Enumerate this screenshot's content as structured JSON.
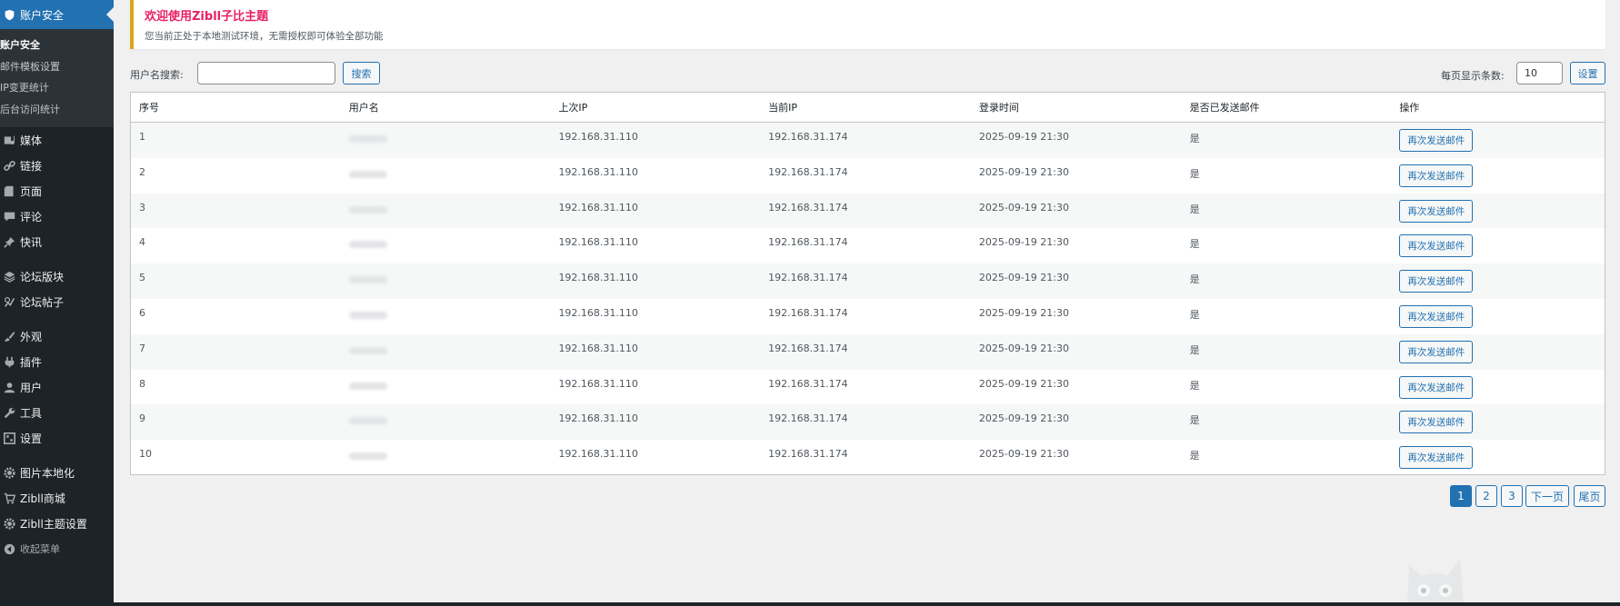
{
  "sidebar": {
    "current": "账户安全",
    "submenu": [
      "账户安全",
      "邮件模板设置",
      "IP变更统计",
      "后台访问统计"
    ],
    "items": [
      {
        "label": "媒体",
        "icon": "media-icon"
      },
      {
        "label": "链接",
        "icon": "link-icon"
      },
      {
        "label": "页面",
        "icon": "page-icon"
      },
      {
        "label": "评论",
        "icon": "comment-icon"
      },
      {
        "label": "快讯",
        "icon": "pin-icon"
      },
      {
        "label": "论坛版块",
        "icon": "forum-icon"
      },
      {
        "label": "论坛帖子",
        "icon": "post-icon"
      },
      {
        "label": "外观",
        "icon": "brush-icon"
      },
      {
        "label": "插件",
        "icon": "plugin-icon"
      },
      {
        "label": "用户",
        "icon": "user-icon"
      },
      {
        "label": "工具",
        "icon": "wrench-icon"
      },
      {
        "label": "设置",
        "icon": "settings-icon"
      },
      {
        "label": "图片本地化",
        "icon": "gear-icon"
      },
      {
        "label": "Zibll商城",
        "icon": "cart-icon"
      },
      {
        "label": "Zibll主题设置",
        "icon": "gear-icon"
      }
    ],
    "collapse": "收起菜单"
  },
  "notice": {
    "title": "欢迎使用Zibll子比主题",
    "desc": "您当前正处于本地测试环境，无需授权即可体验全部功能"
  },
  "toolbar": {
    "search_label": "用户名搜索:",
    "search_value": "",
    "search_button": "搜索",
    "per_page_label": "每页显示条数:",
    "per_page_value": "10",
    "set_button": "设置"
  },
  "table": {
    "headers": [
      "序号",
      "用户名",
      "上次IP",
      "当前IP",
      "登录时间",
      "是否已发送邮件",
      "操作"
    ],
    "rows": [
      {
        "no": "1",
        "prev_ip": "192.168.31.110",
        "cur_ip": "192.168.31.174",
        "time": "2025-09-19 21:30",
        "sent": "是",
        "action": "再次发送邮件"
      },
      {
        "no": "2",
        "prev_ip": "192.168.31.110",
        "cur_ip": "192.168.31.174",
        "time": "2025-09-19 21:30",
        "sent": "是",
        "action": "再次发送邮件"
      },
      {
        "no": "3",
        "prev_ip": "192.168.31.110",
        "cur_ip": "192.168.31.174",
        "time": "2025-09-19 21:30",
        "sent": "是",
        "action": "再次发送邮件"
      },
      {
        "no": "4",
        "prev_ip": "192.168.31.110",
        "cur_ip": "192.168.31.174",
        "time": "2025-09-19 21:30",
        "sent": "是",
        "action": "再次发送邮件"
      },
      {
        "no": "5",
        "prev_ip": "192.168.31.110",
        "cur_ip": "192.168.31.174",
        "time": "2025-09-19 21:30",
        "sent": "是",
        "action": "再次发送邮件"
      },
      {
        "no": "6",
        "prev_ip": "192.168.31.110",
        "cur_ip": "192.168.31.174",
        "time": "2025-09-19 21:30",
        "sent": "是",
        "action": "再次发送邮件"
      },
      {
        "no": "7",
        "prev_ip": "192.168.31.110",
        "cur_ip": "192.168.31.174",
        "time": "2025-09-19 21:30",
        "sent": "是",
        "action": "再次发送邮件"
      },
      {
        "no": "8",
        "prev_ip": "192.168.31.110",
        "cur_ip": "192.168.31.174",
        "time": "2025-09-19 21:30",
        "sent": "是",
        "action": "再次发送邮件"
      },
      {
        "no": "9",
        "prev_ip": "192.168.31.110",
        "cur_ip": "192.168.31.174",
        "time": "2025-09-19 21:30",
        "sent": "是",
        "action": "再次发送邮件"
      },
      {
        "no": "10",
        "prev_ip": "192.168.31.110",
        "cur_ip": "192.168.31.174",
        "time": "2025-09-19 21:30",
        "sent": "是",
        "action": "再次发送邮件"
      }
    ]
  },
  "pagination": {
    "pages": [
      "1",
      "2",
      "3"
    ],
    "current": "1",
    "next": "下一页",
    "last": "尾页"
  },
  "colors": {
    "sidebar_bg": "#1d2327",
    "accent": "#2271b1",
    "notice_title": "#e91e63",
    "notice_border": "#dba617"
  }
}
